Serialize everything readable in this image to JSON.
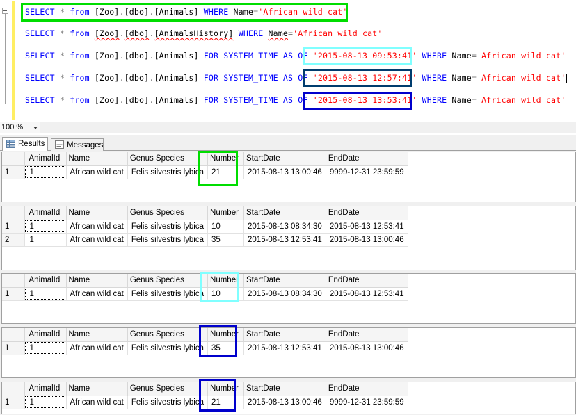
{
  "editor": {
    "lines": [
      {
        "tokens": [
          {
            "t": "SELECT",
            "c": "kw"
          },
          {
            "t": " ",
            "c": "id"
          },
          {
            "t": "*",
            "c": "op"
          },
          {
            "t": " ",
            "c": "id"
          },
          {
            "t": "from",
            "c": "kw"
          },
          {
            "t": " [Zoo]",
            "c": "id"
          },
          {
            "t": ".",
            "c": "op"
          },
          {
            "t": "[dbo]",
            "c": "id"
          },
          {
            "t": ".",
            "c": "op"
          },
          {
            "t": "[Animals] ",
            "c": "id"
          },
          {
            "t": "WHERE",
            "c": "kw"
          },
          {
            "t": " Name",
            "c": "id"
          },
          {
            "t": "=",
            "c": "op"
          },
          {
            "t": "'African wild cat'",
            "c": "str"
          }
        ]
      },
      {
        "tokens": [
          {
            "t": "SELECT",
            "c": "kw"
          },
          {
            "t": " ",
            "c": "id"
          },
          {
            "t": "*",
            "c": "op"
          },
          {
            "t": " ",
            "c": "id"
          },
          {
            "t": "from",
            "c": "kw"
          },
          {
            "t": " ",
            "c": "id"
          },
          {
            "t": "[Zoo]",
            "c": "id squig"
          },
          {
            "t": ".",
            "c": "op"
          },
          {
            "t": "[dbo]",
            "c": "id squig"
          },
          {
            "t": ".",
            "c": "op"
          },
          {
            "t": "[AnimalsHistory]",
            "c": "id squig"
          },
          {
            "t": " ",
            "c": "id"
          },
          {
            "t": "WHERE",
            "c": "kw"
          },
          {
            "t": " ",
            "c": "id"
          },
          {
            "t": "Name",
            "c": "id squig"
          },
          {
            "t": "=",
            "c": "op"
          },
          {
            "t": "'African wild cat'",
            "c": "str"
          }
        ]
      },
      {
        "tokens": [
          {
            "t": "SELECT",
            "c": "kw"
          },
          {
            "t": " ",
            "c": "id"
          },
          {
            "t": "*",
            "c": "op"
          },
          {
            "t": " ",
            "c": "id"
          },
          {
            "t": "from",
            "c": "kw"
          },
          {
            "t": " [Zoo]",
            "c": "id"
          },
          {
            "t": ".",
            "c": "op"
          },
          {
            "t": "[dbo]",
            "c": "id"
          },
          {
            "t": ".",
            "c": "op"
          },
          {
            "t": "[Animals] ",
            "c": "id"
          },
          {
            "t": "FOR",
            "c": "kw"
          },
          {
            "t": " ",
            "c": "id"
          },
          {
            "t": "SYSTEM_TIME",
            "c": "kw"
          },
          {
            "t": " ",
            "c": "id"
          },
          {
            "t": "AS",
            "c": "kw"
          },
          {
            "t": " ",
            "c": "id"
          },
          {
            "t": "OF",
            "c": "kw"
          },
          {
            "t": " ",
            "c": "id"
          },
          {
            "t": "'2015-08-13 09:53:41'",
            "c": "str"
          },
          {
            "t": " ",
            "c": "id"
          },
          {
            "t": "WHERE",
            "c": "kw"
          },
          {
            "t": " Name",
            "c": "id"
          },
          {
            "t": "=",
            "c": "op"
          },
          {
            "t": "'African wild cat'",
            "c": "str"
          }
        ]
      },
      {
        "tokens": [
          {
            "t": "SELECT",
            "c": "kw"
          },
          {
            "t": " ",
            "c": "id"
          },
          {
            "t": "*",
            "c": "op"
          },
          {
            "t": " ",
            "c": "id"
          },
          {
            "t": "from",
            "c": "kw"
          },
          {
            "t": " [Zoo]",
            "c": "id"
          },
          {
            "t": ".",
            "c": "op"
          },
          {
            "t": "[dbo]",
            "c": "id"
          },
          {
            "t": ".",
            "c": "op"
          },
          {
            "t": "[Animals] ",
            "c": "id"
          },
          {
            "t": "FOR",
            "c": "kw"
          },
          {
            "t": " ",
            "c": "id"
          },
          {
            "t": "SYSTEM_TIME",
            "c": "kw"
          },
          {
            "t": " ",
            "c": "id"
          },
          {
            "t": "AS",
            "c": "kw"
          },
          {
            "t": " ",
            "c": "id"
          },
          {
            "t": "OF",
            "c": "kw"
          },
          {
            "t": " ",
            "c": "id"
          },
          {
            "t": "'2015-08-13 12:57:41'",
            "c": "str"
          },
          {
            "t": " ",
            "c": "id"
          },
          {
            "t": "WHERE",
            "c": "kw"
          },
          {
            "t": " Name",
            "c": "id"
          },
          {
            "t": "=",
            "c": "op"
          },
          {
            "t": "'African wild cat'",
            "c": "str"
          }
        ],
        "caret": true
      },
      {
        "tokens": [
          {
            "t": "SELECT",
            "c": "kw"
          },
          {
            "t": " ",
            "c": "id"
          },
          {
            "t": "*",
            "c": "op"
          },
          {
            "t": " ",
            "c": "id"
          },
          {
            "t": "from",
            "c": "kw"
          },
          {
            "t": " [Zoo]",
            "c": "id"
          },
          {
            "t": ".",
            "c": "op"
          },
          {
            "t": "[dbo]",
            "c": "id"
          },
          {
            "t": ".",
            "c": "op"
          },
          {
            "t": "[Animals] ",
            "c": "id"
          },
          {
            "t": "FOR",
            "c": "kw"
          },
          {
            "t": " ",
            "c": "id"
          },
          {
            "t": "SYSTEM_TIME",
            "c": "kw"
          },
          {
            "t": " ",
            "c": "id"
          },
          {
            "t": "AS",
            "c": "kw"
          },
          {
            "t": " ",
            "c": "id"
          },
          {
            "t": "OF",
            "c": "kw"
          },
          {
            "t": " ",
            "c": "id"
          },
          {
            "t": "'2015-08-13 13:53:41'",
            "c": "str"
          },
          {
            "t": " ",
            "c": "id"
          },
          {
            "t": "WHERE",
            "c": "kw"
          },
          {
            "t": " Name",
            "c": "id"
          },
          {
            "t": "=",
            "c": "op"
          },
          {
            "t": "'African wild cat'",
            "c": "str"
          }
        ]
      }
    ]
  },
  "zoom": {
    "value": "100 %"
  },
  "tabs": [
    {
      "label": "Results",
      "icon": "grid-icon",
      "active": true
    },
    {
      "label": "Messages",
      "icon": "messages-icon",
      "active": false
    }
  ],
  "grids": {
    "columns": [
      "AnimalId",
      "Name",
      "Genus Species",
      "Number",
      "StartDate",
      "EndDate"
    ],
    "results": [
      {
        "rows": [
          {
            "row": "1",
            "cells": [
              "1",
              "African wild cat",
              "Felis silvestris lybica",
              "21",
              "2015-08-13 13:00:46",
              "9999-12-31 23:59:59"
            ]
          }
        ]
      },
      {
        "rows": [
          {
            "row": "1",
            "cells": [
              "1",
              "African wild cat",
              "Felis silvestris lybica",
              "10",
              "2015-08-13 08:34:30",
              "2015-08-13 12:53:41"
            ]
          },
          {
            "row": "2",
            "cells": [
              "1",
              "African wild cat",
              "Felis silvestris lybica",
              "35",
              "2015-08-13 12:53:41",
              "2015-08-13 13:00:46"
            ]
          }
        ]
      },
      {
        "rows": [
          {
            "row": "1",
            "cells": [
              "1",
              "African wild cat",
              "Felis silvestris lybica",
              "10",
              "2015-08-13 08:34:30",
              "2015-08-13 12:53:41"
            ]
          }
        ]
      },
      {
        "rows": [
          {
            "row": "1",
            "cells": [
              "1",
              "African wild cat",
              "Felis silvestris lybica",
              "35",
              "2015-08-13 12:53:41",
              "2015-08-13 13:00:46"
            ]
          }
        ]
      },
      {
        "rows": [
          {
            "row": "1",
            "cells": [
              "1",
              "African wild cat",
              "Felis silvestris lybica",
              "21",
              "2015-08-13 13:00:46",
              "9999-12-31 23:59:59"
            ]
          }
        ]
      }
    ]
  },
  "highlight_colors": {
    "green": "#00dd00",
    "cyan": "#80ffff",
    "dark_teal": "#003c6e",
    "blue": "#0000cc"
  }
}
